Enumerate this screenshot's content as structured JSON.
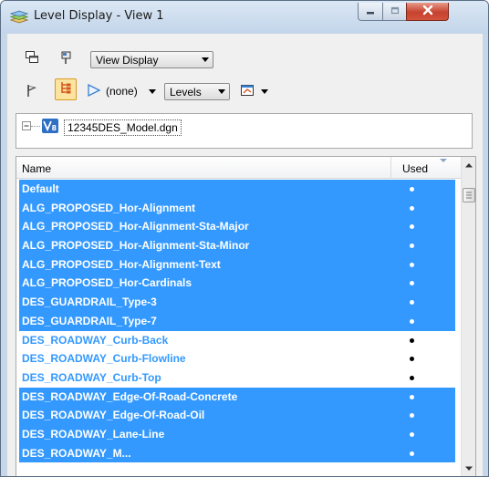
{
  "window": {
    "title": "Level Display - View 1",
    "icons": [
      "layers-icon",
      "minimize-icon",
      "maximize-icon",
      "close-icon"
    ]
  },
  "toolbar": {
    "view_display_label": "View Display",
    "filter_label": "(none)",
    "levels_label": "Levels"
  },
  "tree": {
    "model_label": "12345DES_Model.dgn"
  },
  "list": {
    "headers": {
      "name": "Name",
      "used": "Used"
    },
    "rows": [
      {
        "name": "Default",
        "used": true,
        "selected": true
      },
      {
        "name": "ALG_PROPOSED_Hor-Alignment",
        "used": true,
        "selected": true
      },
      {
        "name": "ALG_PROPOSED_Hor-Alignment-Sta-Major",
        "used": true,
        "selected": true
      },
      {
        "name": "ALG_PROPOSED_Hor-Alignment-Sta-Minor",
        "used": true,
        "selected": true
      },
      {
        "name": "ALG_PROPOSED_Hor-Alignment-Text",
        "used": true,
        "selected": true
      },
      {
        "name": "ALG_PROPOSED_Hor-Cardinals",
        "used": true,
        "selected": true
      },
      {
        "name": "DES_GUARDRAIL_Type-3",
        "used": true,
        "selected": true
      },
      {
        "name": "DES_GUARDRAIL_Type-7",
        "used": true,
        "selected": true
      },
      {
        "name": "DES_ROADWAY_Curb-Back",
        "used": true,
        "selected": false
      },
      {
        "name": "DES_ROADWAY_Curb-Flowline",
        "used": true,
        "selected": false
      },
      {
        "name": "DES_ROADWAY_Curb-Top",
        "used": true,
        "selected": false
      },
      {
        "name": "DES_ROADWAY_Edge-Of-Road-Concrete",
        "used": true,
        "selected": true
      },
      {
        "name": "DES_ROADWAY_Edge-Of-Road-Oil",
        "used": true,
        "selected": true
      },
      {
        "name": "DES_ROADWAY_Lane-Line",
        "used": true,
        "selected": true
      },
      {
        "name": "DES_ROADWAY_M...",
        "used": true,
        "selected": true
      }
    ]
  },
  "colors": {
    "selection": "#3399ff",
    "unselected_text": "#3399ff",
    "close_button": "#c5422e"
  }
}
